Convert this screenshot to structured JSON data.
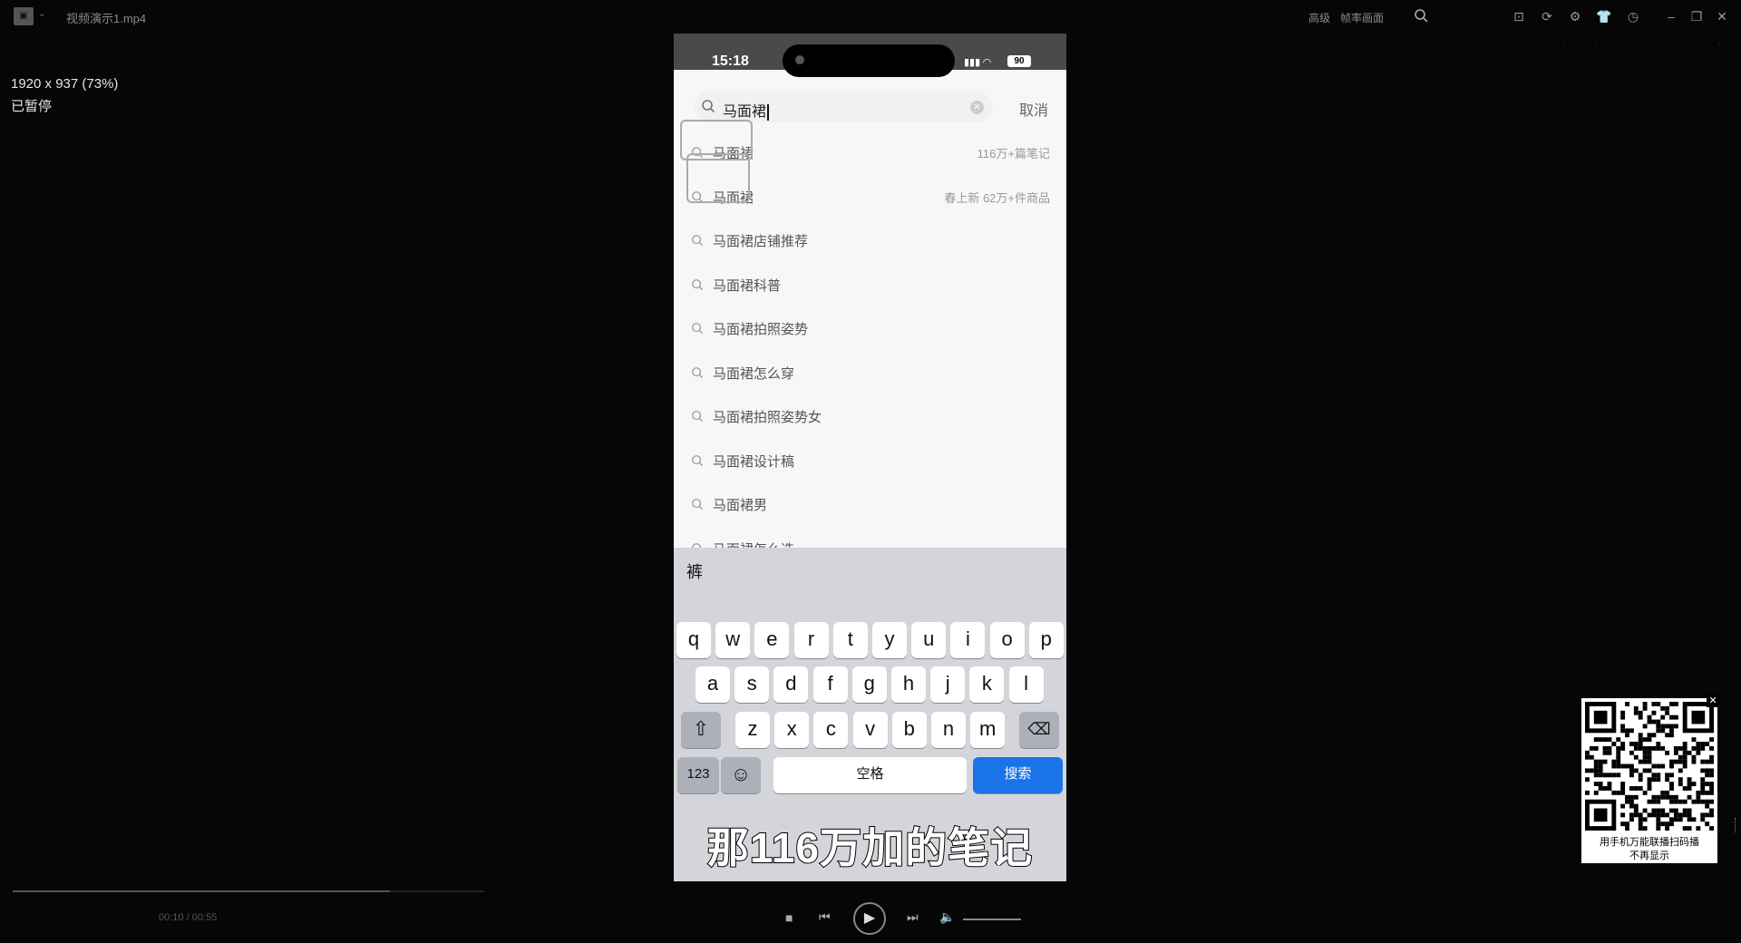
{
  "window": {
    "title": "视频演示1.mp4",
    "right_text_1": "高级",
    "right_text_2": "帧率画面"
  },
  "info": {
    "resolution": "1920 x 937 (73%)",
    "status": "已暂停"
  },
  "phone": {
    "time": "15:18",
    "battery": "90",
    "search": {
      "query": "马面裙",
      "cancel": "取消"
    },
    "suggestions": [
      {
        "label": "马面裙",
        "meta": "116万+篇笔记"
      },
      {
        "label": "马面裙",
        "meta": "春上新 62万+件商品"
      },
      {
        "label": "马面裙店铺推荐",
        "meta": ""
      },
      {
        "label": "马面裙科普",
        "meta": ""
      },
      {
        "label": "马面裙拍照姿势",
        "meta": ""
      },
      {
        "label": "马面裙怎么穿",
        "meta": ""
      },
      {
        "label": "马面裙拍照姿势女",
        "meta": ""
      },
      {
        "label": "马面裙设计稿",
        "meta": ""
      },
      {
        "label": "马面裙男",
        "meta": ""
      },
      {
        "label": "马面裙怎么选",
        "meta": ""
      }
    ],
    "keyboard": {
      "candidate": "裤",
      "row1": [
        "q",
        "w",
        "e",
        "r",
        "t",
        "y",
        "u",
        "i",
        "o",
        "p"
      ],
      "row2": [
        "a",
        "s",
        "d",
        "f",
        "g",
        "h",
        "j",
        "k",
        "l"
      ],
      "row3": [
        "z",
        "x",
        "c",
        "v",
        "b",
        "n",
        "m"
      ],
      "numbers": "123",
      "space": "空格",
      "search": "搜索"
    },
    "subtitle": "那116万加的笔记"
  },
  "qr_popup": {
    "line1": "用手机万能联播扫码播",
    "line2": "不再显示"
  },
  "player": {
    "timecode": "00:10 / 00:55",
    "progress": 0.8
  }
}
